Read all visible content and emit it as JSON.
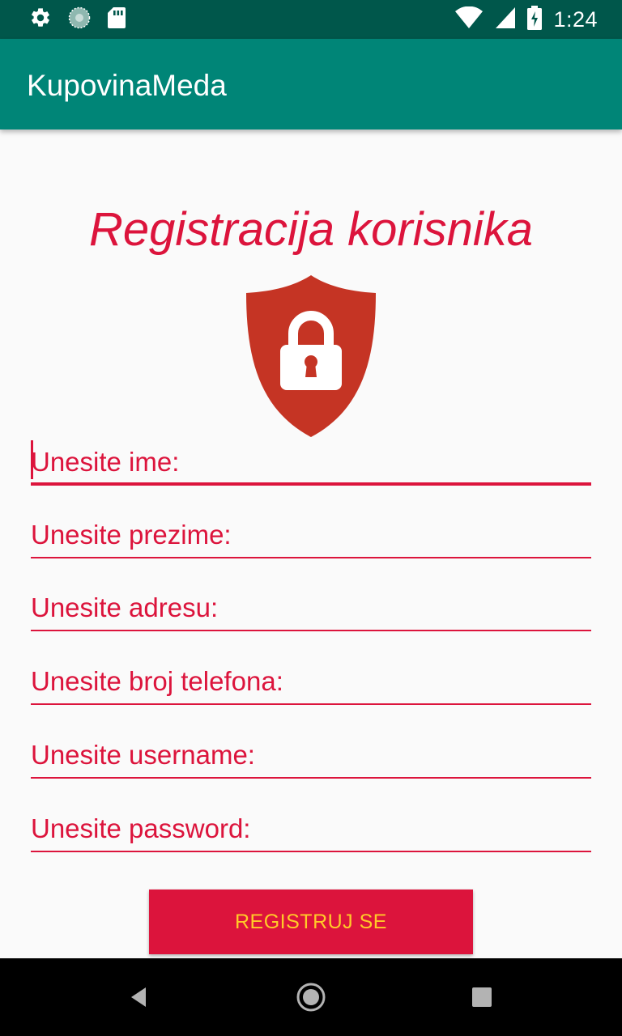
{
  "status_bar": {
    "time": "1:24",
    "left_icons": [
      "settings-icon",
      "sync-icon",
      "sd-card-icon"
    ],
    "right_icons": [
      "wifi-icon",
      "signal-icon",
      "battery-charging-icon"
    ]
  },
  "app_bar": {
    "title": "KupovinaMeda"
  },
  "form": {
    "heading": "Registracija korisnika",
    "icon": "shield-lock-icon",
    "fields": [
      {
        "placeholder": "Unesite ime:",
        "value": ""
      },
      {
        "placeholder": "Unesite prezime:",
        "value": ""
      },
      {
        "placeholder": "Unesite adresu:",
        "value": ""
      },
      {
        "placeholder": "Unesite broj telefona:",
        "value": ""
      },
      {
        "placeholder": "Unesite username:",
        "value": ""
      },
      {
        "placeholder": "Unesite password:",
        "value": ""
      }
    ],
    "submit_label": "REGISTRUJ SE"
  },
  "nav_bar": {
    "icons": [
      "back-icon",
      "home-icon",
      "recents-icon"
    ]
  },
  "colors": {
    "status_bar": "#00574b",
    "app_bar": "#008577",
    "accent": "#dc143c",
    "button_text": "#ffca28",
    "shield": "#c53424",
    "background": "#fafafa"
  }
}
